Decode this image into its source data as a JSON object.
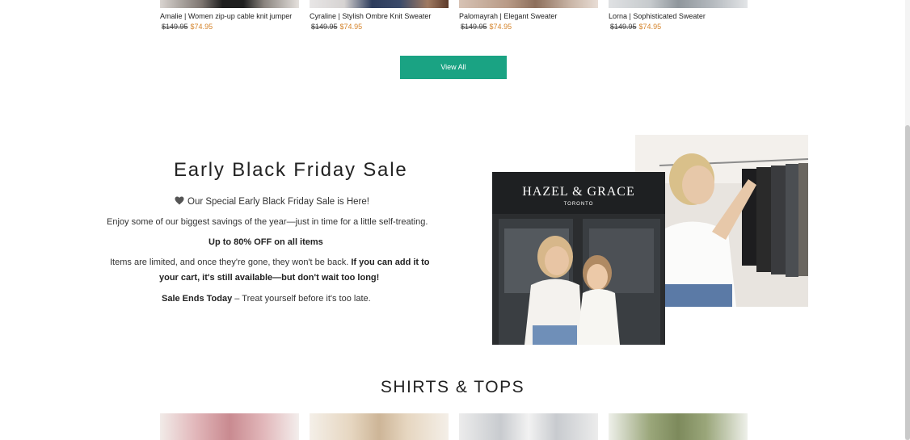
{
  "products_top": [
    {
      "name": "Amalie | Women zip-up cable knit jumper",
      "old_price": "$149.95",
      "new_price": "$74.95",
      "thumb_color": "#7d7570"
    },
    {
      "name": "Cyraline | Stylish Ombre Knit Sweater",
      "old_price": "$149.95",
      "new_price": "$74.95",
      "thumb_color": "#3b4a6a"
    },
    {
      "name": "Palomayrah | Elegant Sweater",
      "old_price": "$149.95",
      "new_price": "$74.95",
      "thumb_color": "#b89a86"
    },
    {
      "name": "Lorna | Sophisticated Sweater",
      "old_price": "$149.95",
      "new_price": "$74.95",
      "thumb_color": "#a7adb4"
    }
  ],
  "view_all": {
    "label": "View All"
  },
  "promo": {
    "title": "Early Black Friday Sale",
    "subtitle": "Our Special Early Black Friday Sale is Here!",
    "line1": "Enjoy some of our biggest savings of the year—just in time for a little self-treating.",
    "line2": "Up to 80% OFF on all items",
    "line3_plain": "Items are limited, and once they're gone, they won't be back.",
    "line3_bold": "If you can add it to",
    "line4_bold": "your cart, it's still available—but don't wait too long!",
    "line5_bold": "Sale Ends Today",
    "line5_plain": "– Treat yourself before it's too late.",
    "store_sign": "HAZEL & GRACE",
    "store_city": "TORONTO"
  },
  "section": {
    "title": "SHIRTS & TOPS"
  },
  "products_bottom": [
    {
      "color": "#e9c4c6"
    },
    {
      "color": "#e6d6c0"
    },
    {
      "color": "#c8cbcf"
    },
    {
      "color": "#9aa67a"
    }
  ],
  "colors": {
    "accent": "#1aa383",
    "sale_price": "#d4832a"
  }
}
